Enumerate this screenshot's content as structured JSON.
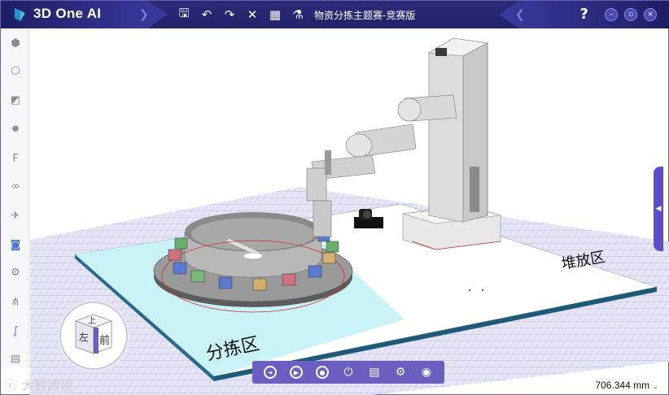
{
  "app": {
    "title": "3D One AI",
    "document_title": "物资分拣主题赛-竞赛版",
    "help_label": "?"
  },
  "toolbar": {
    "icons": [
      "save-icon",
      "undo-icon",
      "redo-icon",
      "close-icon",
      "grid-icon",
      "robot-icon"
    ]
  },
  "window_controls": [
    "minimize-icon",
    "restore-icon",
    "close-icon"
  ],
  "left_toolbar": {
    "items": [
      "cube-icon",
      "hexagon-icon",
      "build-icon",
      "gear-icon",
      "f-icon",
      "link-icon",
      "motion-icon",
      "target-icon",
      "settings-icon",
      "node-icon",
      "path-icon",
      "export-icon"
    ]
  },
  "scene": {
    "sorting_zone_label": "分拣区",
    "stacking_zone_label": "堆放区"
  },
  "view_cube": {
    "top": "上",
    "front": "前",
    "left": "左"
  },
  "bottom_toolbar": {
    "items": [
      "import-icon",
      "play-icon",
      "stop-icon",
      "power-icon",
      "document-icon",
      "settings-icon",
      "visibility-icon"
    ]
  },
  "status": {
    "measurement": "706.344 mm",
    "watermark": "大數跨境"
  },
  "colors": {
    "titlebar": "#22226a",
    "accent": "#6a5fc0",
    "sorting_zone": "#c8f4f6",
    "grid": "#9a9ae0"
  }
}
